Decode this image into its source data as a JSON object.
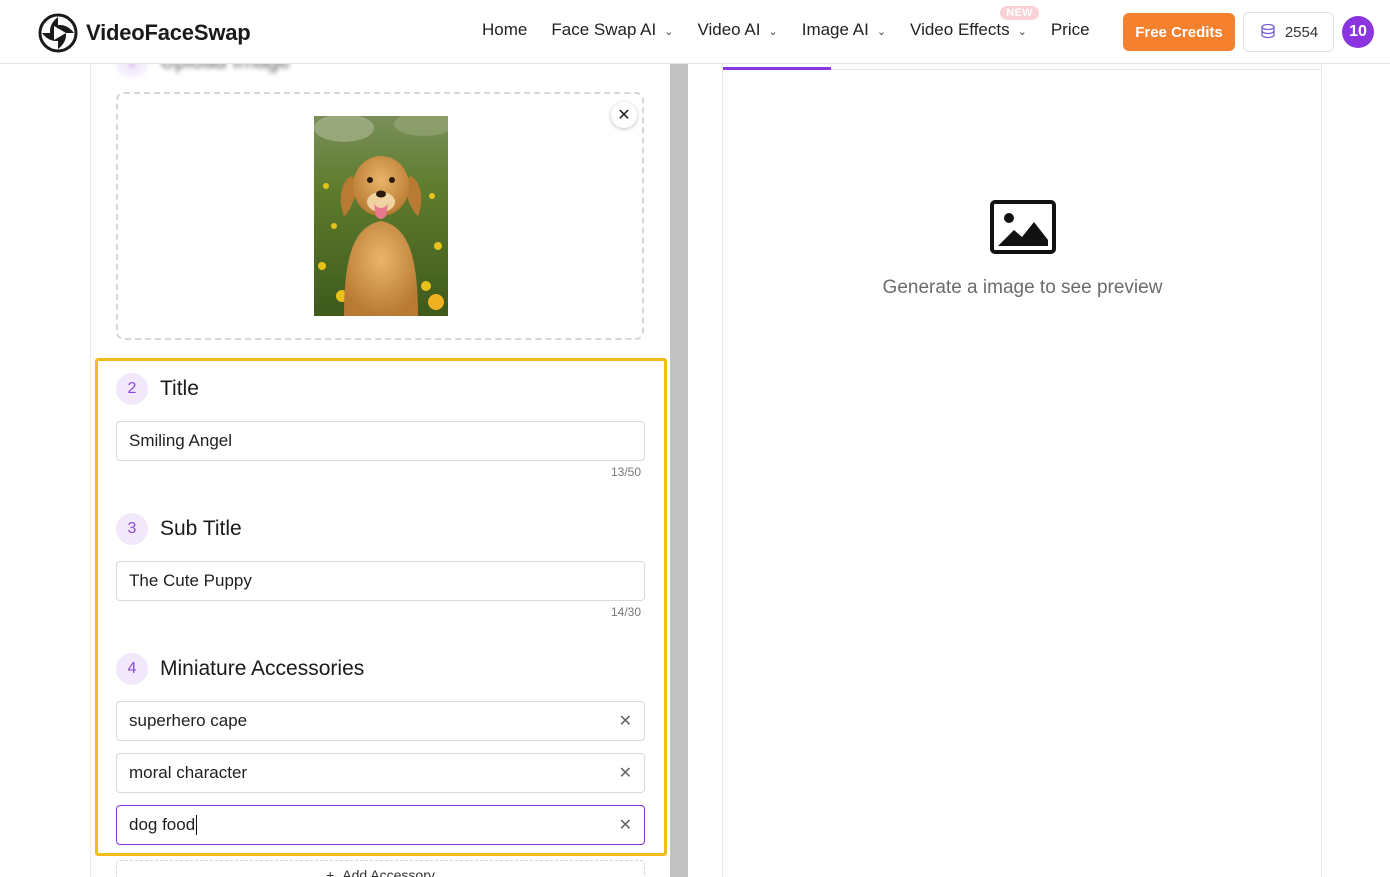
{
  "header": {
    "brand": "VideoFaceSwap",
    "nav": [
      {
        "label": "Home",
        "has_dropdown": false
      },
      {
        "label": "Face Swap AI",
        "has_dropdown": true
      },
      {
        "label": "Video AI",
        "has_dropdown": true
      },
      {
        "label": "Image AI",
        "has_dropdown": true
      },
      {
        "label": "Video Effects",
        "has_dropdown": true,
        "badge": "NEW"
      },
      {
        "label": "Price",
        "has_dropdown": false
      }
    ],
    "free_credits_label": "Free Credits",
    "credits_count": "2554",
    "avatar_label": "10"
  },
  "form": {
    "upload": {
      "step": "1",
      "title": "Upload Image"
    },
    "title_section": {
      "step": "2",
      "label": "Title",
      "value": "Smiling Angel",
      "counter": "13/50"
    },
    "subtitle_section": {
      "step": "3",
      "label": "Sub Title",
      "value": "The Cute Puppy",
      "counter": "14/30"
    },
    "accessories_section": {
      "step": "4",
      "label": "Miniature Accessories",
      "items": [
        "superhero cape",
        "moral character",
        "dog food"
      ],
      "add_label": "Add Accessory"
    }
  },
  "preview": {
    "empty_text": "Generate a image to see preview"
  },
  "colors": {
    "accent": "#8b35e0",
    "cta": "#f5812f",
    "highlight": "#f2bc1c"
  }
}
